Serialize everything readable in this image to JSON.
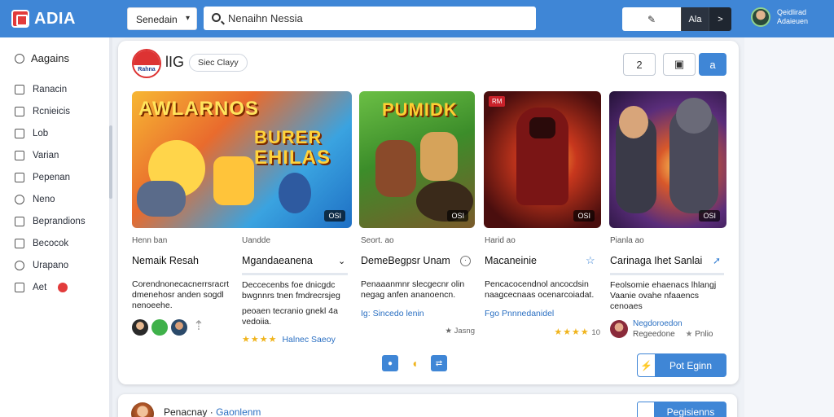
{
  "app": {
    "logo_text": "ADIA"
  },
  "topbar": {
    "select_value": "Senedain",
    "search_value": "Nenaihn Nessia",
    "btn1_icon": "✎",
    "btn2_label": "Ala",
    "btn3_icon": ">",
    "user_line1": "Qeidlirad",
    "user_line2": "Adaieuen"
  },
  "sidebar": {
    "heading": "Aagains",
    "items": [
      {
        "label": "Ranacin"
      },
      {
        "label": "Rcnieicis"
      },
      {
        "label": "Lob"
      },
      {
        "label": "Varian"
      },
      {
        "label": "Pepenan"
      },
      {
        "label": "Neno"
      },
      {
        "label": "Beprandions"
      },
      {
        "label": "Becocok"
      },
      {
        "label": "Urapano"
      },
      {
        "label": "Aet"
      }
    ]
  },
  "header": {
    "brand_text": "Rahna",
    "brand_name": "lIG",
    "chip": "Siec Clayy",
    "ctrl1_icon": "2",
    "ctrl2_icon": "▣",
    "ctrl3_icon": "a"
  },
  "art": {
    "a1_title_line1": "AWLARNOS",
    "a1_title_line2": "BURER",
    "a1_title_line3": "EHILAS",
    "a1_badge": "OSI",
    "a2_title": "PUMIDK",
    "a2_badge": "OSI",
    "a3_badge": "OSI",
    "a3_tag": "RM",
    "a4_badge": "OSI"
  },
  "games": [
    {
      "category": "Henn ban",
      "title": "Nemaik Resah",
      "desc": "Corendnonecacnerrsracrt dmenehosr anden sogdl nenoeehe."
    },
    {
      "category": "Uandde",
      "title": "Mgandaeanena",
      "desc": "Deccecenbs foe dnicgdc bwgnnrs tnen fmdrecrsjeg",
      "desc2": "peoaen tecranio gnekl 4a vedoiia.",
      "rating_label": "Halnec Saeoy"
    },
    {
      "category": "Seort. ao",
      "title": "DemeBegpsr Unam",
      "desc": "Penaaanmnr slecgecnr olin negag anfen ananoencn.",
      "link": "Ig: Sincedo lenin",
      "meta": "Jasng"
    },
    {
      "category": "Harid ao",
      "title": "Macaneinie",
      "desc": "Pencacocendnol ancocdsin naagcecnaas ocenarcoiadat.",
      "link": "Fgo Pnnnedanidel",
      "meta": "10"
    },
    {
      "category": "Pianla ao",
      "title": "Carinaga Ihet Sanlai",
      "desc": "Feolsomie ehaenacs lhlangj Vaanie ovahe nfaaencs cenoaes",
      "author": "Negdoroedon",
      "author_meta": "Regeedone",
      "meta": "Pnlio"
    }
  ],
  "cta_label": "Pot Eginn",
  "bottom": {
    "text": "Penacnay",
    "text_hl": "Gaonlenm",
    "btn": "Pegisienns"
  }
}
